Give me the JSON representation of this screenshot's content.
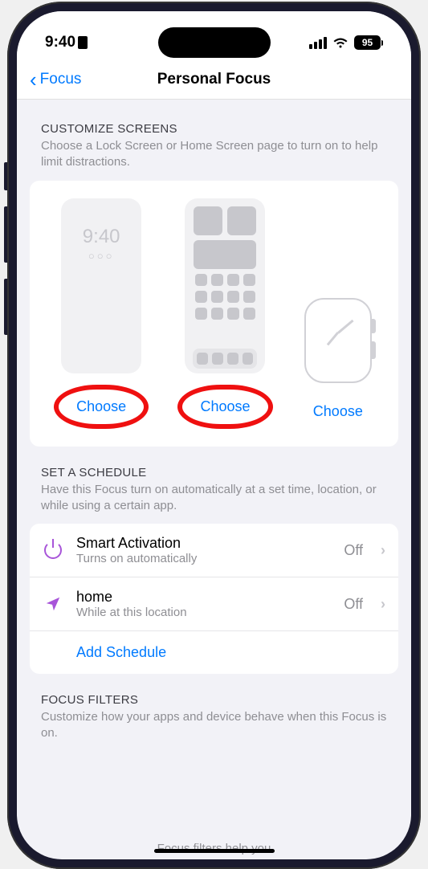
{
  "statusBar": {
    "time": "9:40",
    "battery": "95"
  },
  "nav": {
    "back": "Focus",
    "title": "Personal Focus"
  },
  "customize": {
    "title": "CUSTOMIZE SCREENS",
    "desc": "Choose a Lock Screen or Home Screen page to turn on to help limit distractions.",
    "lockPreviewTime": "9:40",
    "lockPreviewDots": "○○○",
    "chooseLock": "Choose",
    "chooseHome": "Choose",
    "chooseWatch": "Choose"
  },
  "schedule": {
    "title": "SET A SCHEDULE",
    "desc": "Have this Focus turn on automatically at a set time, location, or while using a certain app.",
    "smart": {
      "title": "Smart Activation",
      "sub": "Turns on automatically",
      "value": "Off"
    },
    "home": {
      "title": "home",
      "sub": "While at this location",
      "value": "Off"
    },
    "add": "Add Schedule"
  },
  "filters": {
    "title": "FOCUS FILTERS",
    "desc": "Customize how your apps and device behave when this Focus is on.",
    "peek": "Focus filters help you"
  }
}
